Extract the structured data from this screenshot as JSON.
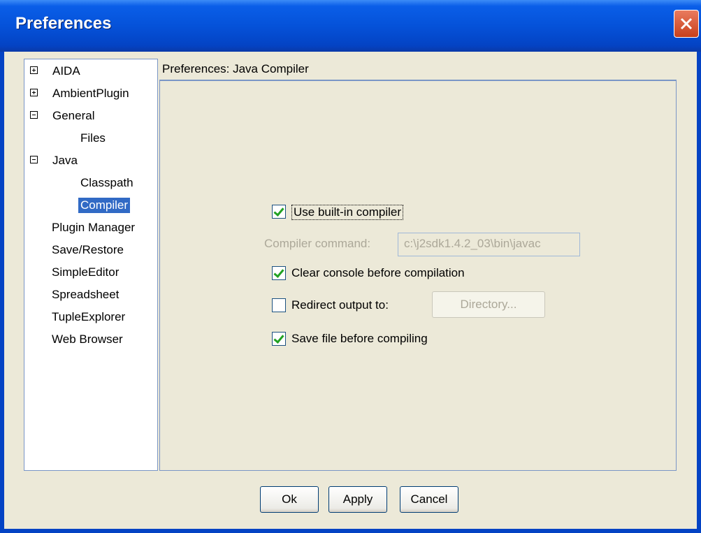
{
  "window": {
    "title": "Preferences"
  },
  "tree": {
    "items": [
      {
        "label": "AIDA",
        "expander": "plus"
      },
      {
        "label": "AmbientPlugin",
        "expander": "plus"
      },
      {
        "label": "General",
        "expander": "minus"
      },
      {
        "label": "Files"
      },
      {
        "label": "Java",
        "expander": "minus"
      },
      {
        "label": "Classpath"
      },
      {
        "label": "Compiler",
        "selected": true
      },
      {
        "label": "Plugin Manager"
      },
      {
        "label": "Save/Restore"
      },
      {
        "label": "SimpleEditor"
      },
      {
        "label": "Spreadsheet"
      },
      {
        "label": "TupleExplorer"
      },
      {
        "label": "Web Browser"
      }
    ]
  },
  "panel": {
    "header": "Preferences: Java Compiler",
    "use_builtin": {
      "label": "Use built-in compiler",
      "checked": true
    },
    "compiler_command": {
      "label": "Compiler command:",
      "value": "c:\\j2sdk1.4.2_03\\bin\\javac"
    },
    "clear_console": {
      "label": "Clear console before compilation",
      "checked": true
    },
    "redirect_output": {
      "label": "Redirect output to:",
      "checked": false,
      "button": "Directory..."
    },
    "save_file": {
      "label": "Save file before compiling",
      "checked": true
    }
  },
  "buttons": {
    "ok": "Ok",
    "apply": "Apply",
    "cancel": "Cancel"
  },
  "colors": {
    "selection": "#316ac5",
    "title_bar": "#0552d9",
    "check": "#21a121"
  }
}
